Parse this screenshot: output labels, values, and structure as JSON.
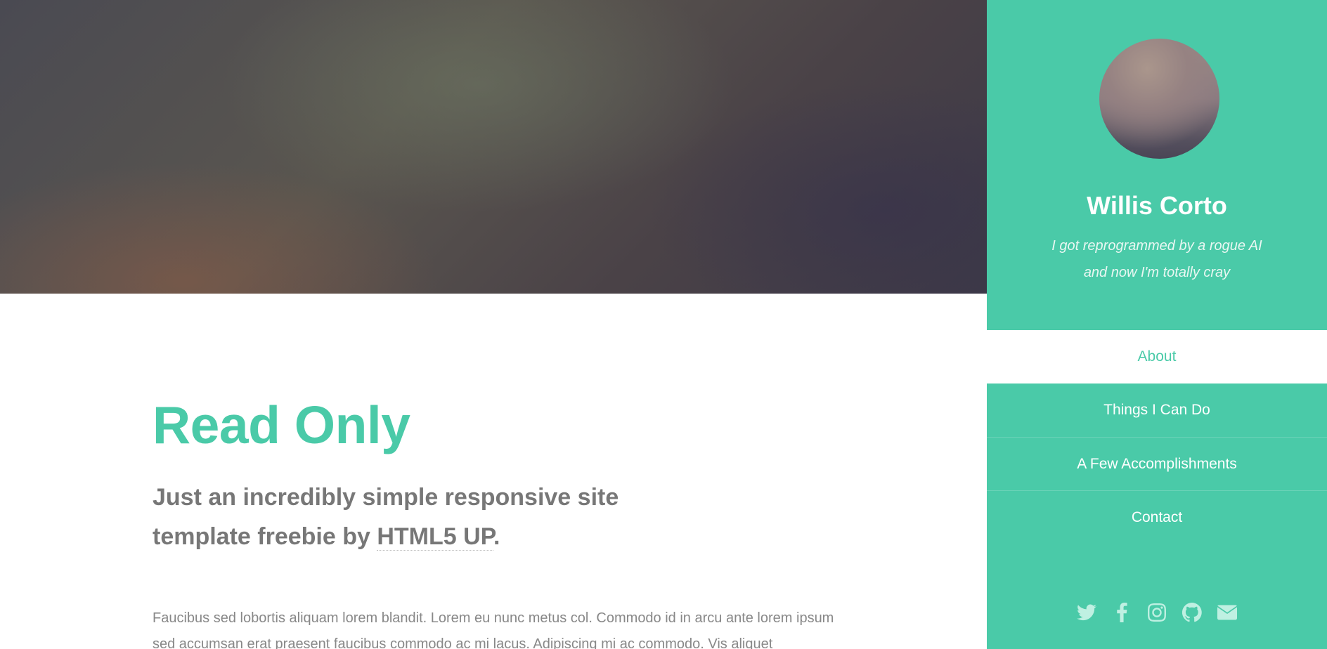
{
  "main": {
    "title": "Read Only",
    "subtitle_prefix": "Just an incredibly simple responsive site template freebie by",
    "subtitle_link": "HTML5 UP",
    "subtitle_suffix": ".",
    "body": "Faucibus sed lobortis aliquam lorem blandit. Lorem eu nunc metus col. Commodo id in arcu ante lorem ipsum sed accumsan erat praesent faucibus commodo ac mi lacus. Adipiscing mi ac commodo. Vis aliquet"
  },
  "sidebar": {
    "name": "Willis Corto",
    "tagline": "I got reprogrammed by a rogue AI and now I'm totally cray",
    "nav": [
      {
        "label": "About",
        "active": true
      },
      {
        "label": "Things I Can Do",
        "active": false
      },
      {
        "label": "A Few Accomplishments",
        "active": false
      },
      {
        "label": "Contact",
        "active": false
      }
    ],
    "social": [
      "twitter-icon",
      "facebook-icon",
      "instagram-icon",
      "github-icon",
      "email-icon"
    ]
  },
  "colors": {
    "accent": "#4acaa8",
    "text": "#777777"
  }
}
